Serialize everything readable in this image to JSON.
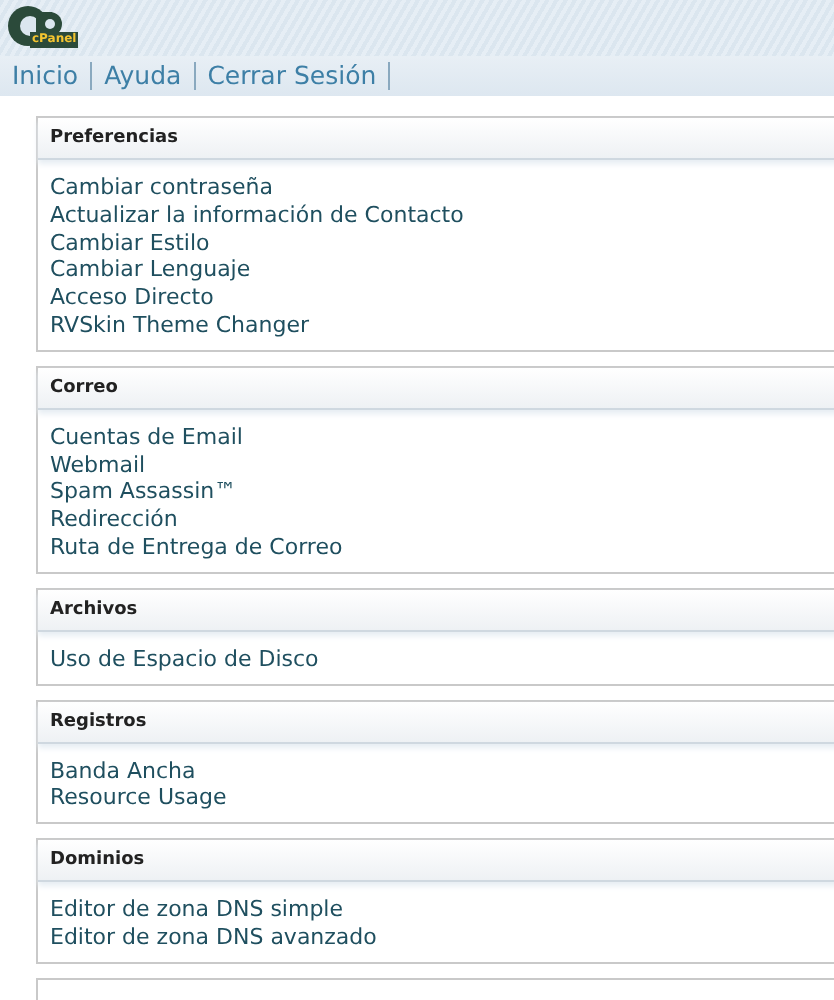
{
  "logo": {
    "text": "cPanel"
  },
  "nav": [
    {
      "label": "Inicio"
    },
    {
      "label": "Ayuda"
    },
    {
      "label": "Cerrar Sesión"
    }
  ],
  "sections": [
    {
      "title": "Preferencias",
      "links": [
        "Cambiar contraseña",
        "Actualizar la información de Contacto",
        "Cambiar Estilo",
        "Cambiar Lenguaje",
        "Acceso Directo",
        "RVSkin Theme Changer"
      ]
    },
    {
      "title": "Correo",
      "links": [
        "Cuentas de Email",
        "Webmail",
        "Spam Assassin™",
        "Redirección",
        "Ruta de Entrega de Correo"
      ]
    },
    {
      "title": "Archivos",
      "links": [
        "Uso de Espacio de Disco"
      ]
    },
    {
      "title": "Registros",
      "links": [
        "Banda Ancha",
        "Resource Usage"
      ]
    },
    {
      "title": "Dominios",
      "links": [
        "Editor de zona DNS simple",
        "Editor de zona DNS avanzado"
      ]
    }
  ]
}
